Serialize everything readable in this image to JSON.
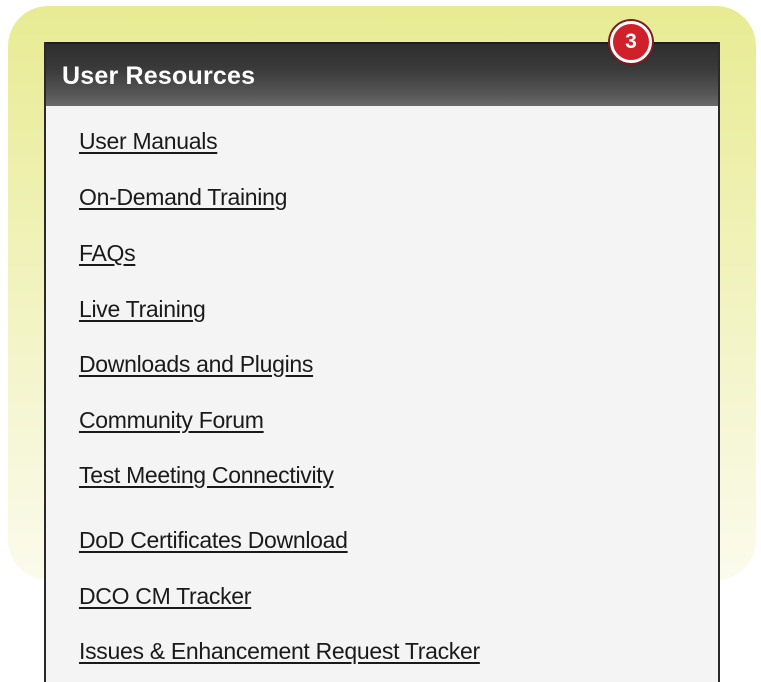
{
  "panel": {
    "title": "User Resources",
    "badge": "3",
    "links": [
      "User Manuals",
      "On-Demand Training",
      "FAQs",
      "Live Training",
      "Downloads and Plugins",
      "Community Forum",
      "Test Meeting Connectivity",
      "DoD Certificates Download",
      "DCO CM Tracker",
      "Issues & Enhancement Request Tracker"
    ]
  },
  "colors": {
    "highlight": "#e8eb93",
    "header": "#2e2e2e",
    "panel_bg": "#f4f4f4",
    "badge": "#d0202a",
    "link": "#1a1a1a"
  }
}
